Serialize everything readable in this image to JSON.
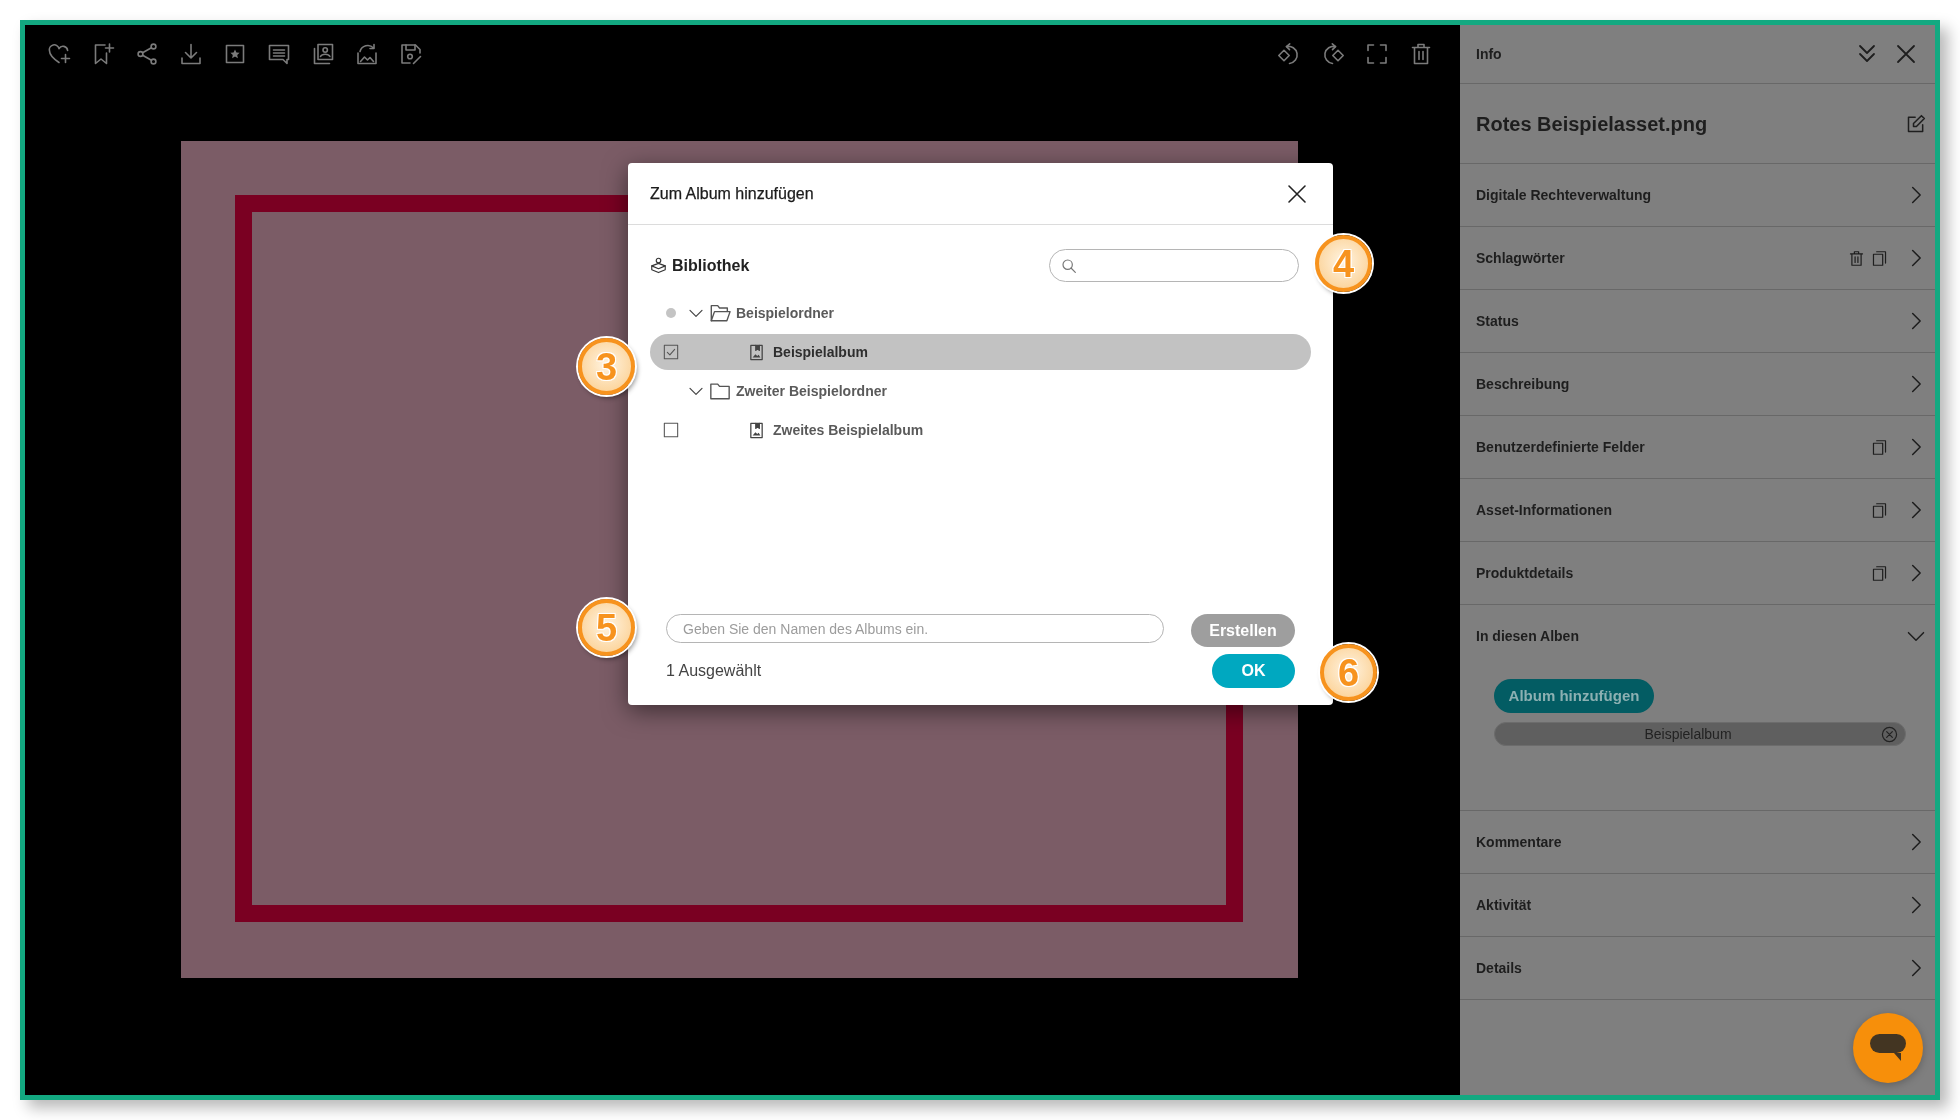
{
  "viewer": {
    "toolbar_left": [
      {
        "kind": "favorite"
      },
      {
        "kind": "bookmark"
      },
      {
        "kind": "share"
      },
      {
        "kind": "download"
      },
      {
        "kind": "rating"
      },
      {
        "kind": "comment"
      },
      {
        "kind": "gallery"
      },
      {
        "kind": "replace"
      },
      {
        "kind": "save"
      }
    ],
    "toolbar_right": [
      {
        "kind": "rotate_left"
      },
      {
        "kind": "rotate_right"
      },
      {
        "kind": "fullscreen"
      },
      {
        "kind": "delete"
      }
    ]
  },
  "info_panel": {
    "title": "Info",
    "asset_name": "Rotes Beispielasset.png",
    "sections": [
      {
        "label": "Digitale Rechteverwaltung",
        "expanded": false
      },
      {
        "label": "Schlagwörter",
        "expanded": false,
        "actions": [
          {
            "kind": "delete"
          },
          {
            "kind": "copy"
          }
        ]
      },
      {
        "label": "Status",
        "expanded": false
      },
      {
        "label": "Beschreibung",
        "expanded": false
      },
      {
        "label": "Benutzerdefinierte Felder",
        "expanded": false,
        "actions": [
          {
            "kind": "copy"
          }
        ]
      },
      {
        "label": "Asset-Informationen",
        "expanded": false,
        "actions": [
          {
            "kind": "copy"
          }
        ]
      },
      {
        "label": "Produktdetails",
        "expanded": false,
        "actions": [
          {
            "kind": "copy"
          }
        ]
      },
      {
        "label": "In diesen Alben",
        "expanded": true,
        "button": "Album hinzufügen",
        "albums": [
          {
            "label": "Beispielalbum"
          }
        ]
      },
      {
        "label": "Kommentare",
        "expanded": false
      },
      {
        "label": "Aktivität",
        "expanded": false
      },
      {
        "label": "Details",
        "expanded": false
      }
    ]
  },
  "dialog": {
    "title": "Zum Album hinzufügen",
    "library_label": "Bibliothek",
    "search": {
      "callout": "4"
    },
    "tree": [
      {
        "kind": "folder",
        "label": "Beispielordner",
        "expanded": true,
        "partially_selected": true,
        "children": [
          {
            "kind": "album",
            "label": "Beispielalbum",
            "checked": true,
            "selected": true,
            "callout": "3"
          }
        ]
      },
      {
        "kind": "folder",
        "label": "Zweiter Beispielordner",
        "expanded": true,
        "partially_selected": false,
        "children": [
          {
            "kind": "album",
            "label": "Zweites Beispielalbum",
            "checked": false,
            "selected": false
          }
        ]
      }
    ],
    "name_field": {
      "placeholder": "Geben Sie den Namen des Albums ein.",
      "callout": "5"
    },
    "create_button": {
      "label": "Erstellen",
      "disabled": true
    },
    "selection_count": "1 Ausgewählt",
    "ok_button": {
      "label": "OK",
      "callout": "6"
    }
  }
}
